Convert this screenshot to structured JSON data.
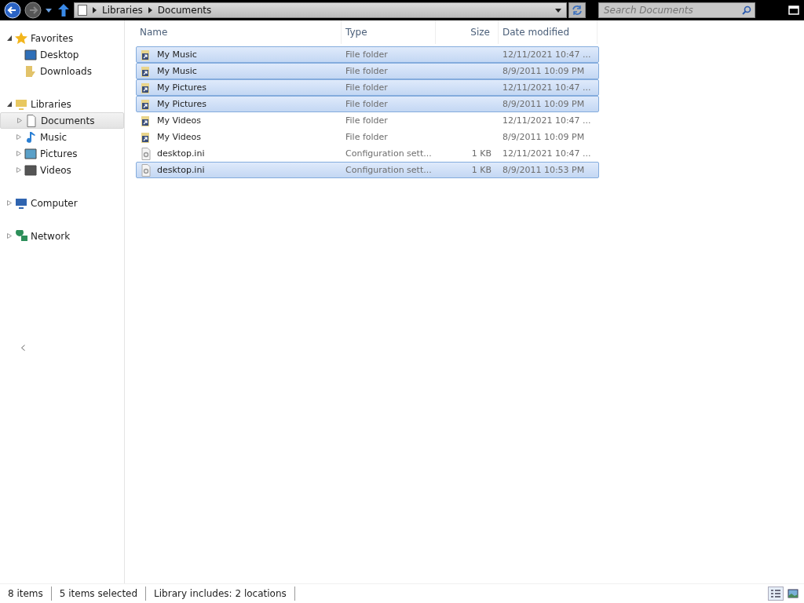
{
  "address": {
    "crumbs": [
      "Libraries",
      "Documents"
    ]
  },
  "search": {
    "placeholder": "Search Documents"
  },
  "sidebar": {
    "items": [
      {
        "label": "Favorites",
        "expanded": true,
        "selected": false,
        "children": [
          {
            "label": "Desktop",
            "selected": false
          },
          {
            "label": "Downloads",
            "selected": false
          }
        ]
      },
      {
        "label": "Libraries",
        "expanded": true,
        "selected": false,
        "children": [
          {
            "label": "Documents",
            "expanded": false,
            "selected": true
          },
          {
            "label": "Music",
            "expanded": false,
            "selected": false
          },
          {
            "label": "Pictures",
            "expanded": false,
            "selected": false
          },
          {
            "label": "Videos",
            "expanded": false,
            "selected": false
          }
        ]
      },
      {
        "label": "Computer",
        "expanded": false,
        "selected": false
      },
      {
        "label": "Network",
        "expanded": false,
        "selected": false
      }
    ]
  },
  "table": {
    "columns": [
      "Name",
      "Type",
      "Size",
      "Date modified"
    ],
    "rows": [
      {
        "kind": "folder",
        "name": "My Music",
        "type": "File folder",
        "date": "12/11/2021 10:47 ...",
        "selected": true
      },
      {
        "kind": "folder",
        "name": "My Music",
        "type": "File folder",
        "date": "8/9/2011 10:09 PM",
        "selected": true
      },
      {
        "kind": "folder",
        "name": "My Pictures",
        "type": "File folder",
        "date": "12/11/2021 10:47 ...",
        "selected": true
      },
      {
        "kind": "folder",
        "name": "My Pictures",
        "type": "File folder",
        "date": "8/9/2011 10:09 PM",
        "selected": true
      },
      {
        "kind": "folder",
        "name": "My Videos",
        "type": "File folder",
        "date": "12/11/2021 10:47 ...",
        "selected": false
      },
      {
        "kind": "folder",
        "name": "My Videos",
        "type": "File folder",
        "date": "8/9/2011 10:09 PM",
        "selected": false
      },
      {
        "kind": "file",
        "name": "desktop.ini",
        "type": "Configuration sett...",
        "size": "1 KB",
        "date": "12/11/2021 10:47 ...",
        "selected": false
      },
      {
        "kind": "file",
        "name": "desktop.ini",
        "type": "Configuration sett...",
        "size": "1 KB",
        "date": "8/9/2011 10:53 PM",
        "selected": true
      }
    ]
  },
  "status_bar": [
    "8 items",
    "5 items selected",
    "Library includes: 2 locations"
  ]
}
